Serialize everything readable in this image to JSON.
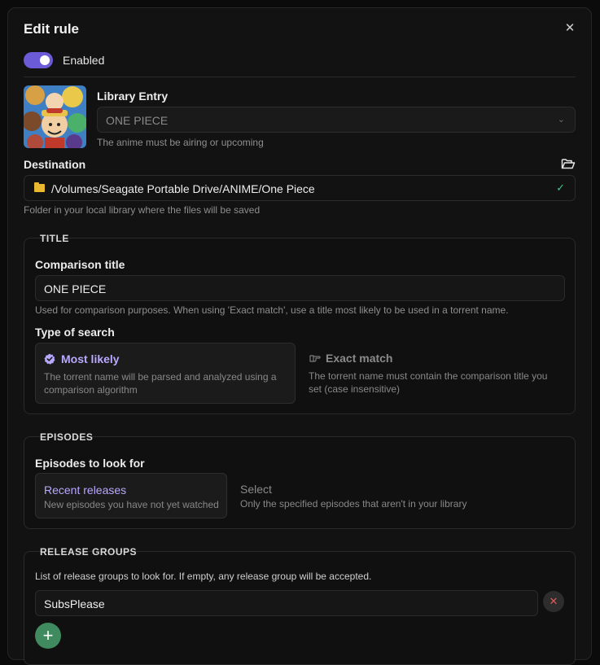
{
  "dialog": {
    "title": "Edit rule",
    "close_icon": "close-icon"
  },
  "enabled": {
    "label": "Enabled",
    "on": true,
    "accent": "#6b5bd6"
  },
  "library_entry": {
    "label": "Library Entry",
    "value": "ONE PIECE",
    "help": "The anime must be airing or upcoming"
  },
  "destination": {
    "label": "Destination",
    "path": "/Volumes/Seagate Portable Drive/ANIME/One Piece",
    "help": "Folder in your local library where the files will be saved"
  },
  "title_section": {
    "heading": "TITLE",
    "comparison_label": "Comparison title",
    "comparison_value": "ONE PIECE",
    "comparison_help": "Used for comparison purposes. When using 'Exact match', use a title most likely to be used in a torrent name.",
    "search_type_label": "Type of search",
    "options": [
      {
        "title": "Most likely",
        "desc": "The torrent name will be parsed and analyzed using a comparison algorithm",
        "selected": true
      },
      {
        "title": "Exact match",
        "desc": "The torrent name must contain the comparison title you set (case insensitive)",
        "selected": false
      }
    ]
  },
  "episodes_section": {
    "heading": "EPISODES",
    "label": "Episodes to look for",
    "options": [
      {
        "title": "Recent releases",
        "desc": "New episodes you have not yet watched",
        "selected": true
      },
      {
        "title": "Select",
        "desc": "Only the specified episodes that aren't in your library",
        "selected": false
      }
    ]
  },
  "release_groups_section": {
    "heading": "RELEASE GROUPS",
    "help": "List of release groups to look for. If empty, any release group will be accepted.",
    "groups": [
      "SubsPlease"
    ]
  },
  "colors": {
    "accent": "#6b5bd6",
    "success": "#48c58a",
    "danger": "#e05a5a",
    "add": "#3f8a5e",
    "selected_title": "#b9a8ff"
  }
}
